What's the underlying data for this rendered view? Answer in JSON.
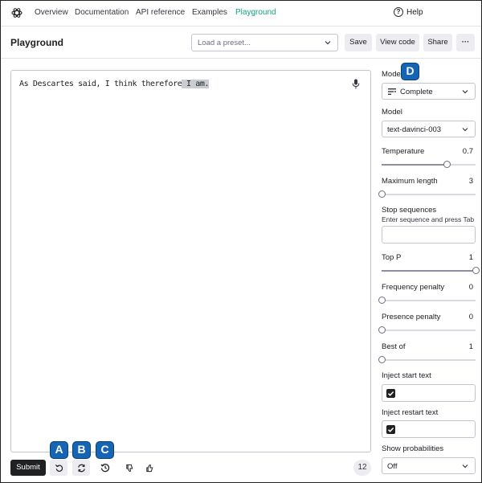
{
  "nav": {
    "links": [
      "Overview",
      "Documentation",
      "API reference",
      "Examples",
      "Playground"
    ],
    "help_label": "Help",
    "help_glyph": "?"
  },
  "header": {
    "title": "Playground",
    "preset_placeholder": "Load a preset...",
    "save_label": "Save",
    "view_code_label": "View code",
    "share_label": "Share",
    "more_label": "···"
  },
  "editor": {
    "text_plain": "As Descartes said, I think therefore",
    "text_highlighted": " I am."
  },
  "bottom": {
    "submit_label": "Submit",
    "token_count": "12"
  },
  "callouts": {
    "a": "A",
    "b": "B",
    "c": "C",
    "d": "D"
  },
  "settings": {
    "mode_label": "Mode",
    "mode_value": "Complete",
    "model_label": "Model",
    "model_value": "text-davinci-003",
    "temperature_label": "Temperature",
    "temperature_value": "0.7",
    "temperature_fraction": 0.7,
    "max_length_label": "Maximum length",
    "max_length_value": "3",
    "max_length_fraction": 0,
    "stop_label": "Stop sequences",
    "stop_hint": "Enter sequence and press Tab",
    "top_p_label": "Top P",
    "top_p_value": "1",
    "top_p_fraction": 1,
    "freq_label": "Frequency penalty",
    "freq_value": "0",
    "freq_fraction": 0,
    "presence_label": "Presence penalty",
    "presence_value": "0",
    "presence_fraction": 0,
    "best_of_label": "Best of",
    "best_of_value": "1",
    "best_of_fraction": 0,
    "inject_start_label": "Inject start text",
    "inject_start_checked": true,
    "inject_restart_label": "Inject restart text",
    "inject_restart_checked": true,
    "show_prob_label": "Show probabilities",
    "show_prob_value": "Off"
  },
  "colors": {
    "accent": "#10a37f",
    "callout": "#1565b4",
    "dark": "#202123"
  }
}
